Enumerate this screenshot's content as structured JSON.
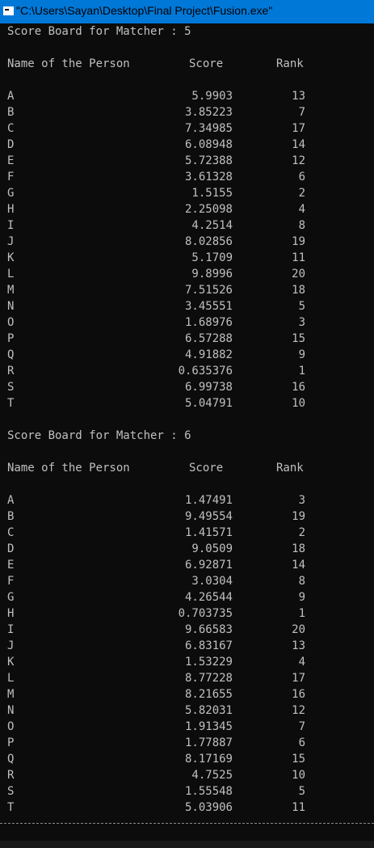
{
  "window": {
    "title": "\"C:\\Users\\Sayan\\Desktop\\Final Project\\Fusion.exe\""
  },
  "headers": {
    "name": "Name of the Person",
    "score": "Score",
    "rank": "Rank"
  },
  "boards": [
    {
      "title": "Score Board for Matcher : 5",
      "rows": [
        {
          "name": "A",
          "score": "5.9903",
          "rank": "13"
        },
        {
          "name": "B",
          "score": "3.85223",
          "rank": "7"
        },
        {
          "name": "C",
          "score": "7.34985",
          "rank": "17"
        },
        {
          "name": "D",
          "score": "6.08948",
          "rank": "14"
        },
        {
          "name": "E",
          "score": "5.72388",
          "rank": "12"
        },
        {
          "name": "F",
          "score": "3.61328",
          "rank": "6"
        },
        {
          "name": "G",
          "score": "1.5155",
          "rank": "2"
        },
        {
          "name": "H",
          "score": "2.25098",
          "rank": "4"
        },
        {
          "name": "I",
          "score": "4.2514",
          "rank": "8"
        },
        {
          "name": "J",
          "score": "8.02856",
          "rank": "19"
        },
        {
          "name": "K",
          "score": "5.1709",
          "rank": "11"
        },
        {
          "name": "L",
          "score": "9.8996",
          "rank": "20"
        },
        {
          "name": "M",
          "score": "7.51526",
          "rank": "18"
        },
        {
          "name": "N",
          "score": "3.45551",
          "rank": "5"
        },
        {
          "name": "O",
          "score": "1.68976",
          "rank": "3"
        },
        {
          "name": "P",
          "score": "6.57288",
          "rank": "15"
        },
        {
          "name": "Q",
          "score": "4.91882",
          "rank": "9"
        },
        {
          "name": "R",
          "score": "0.635376",
          "rank": "1"
        },
        {
          "name": "S",
          "score": "6.99738",
          "rank": "16"
        },
        {
          "name": "T",
          "score": "5.04791",
          "rank": "10"
        }
      ]
    },
    {
      "title": "Score Board for Matcher : 6",
      "rows": [
        {
          "name": "A",
          "score": "1.47491",
          "rank": "3"
        },
        {
          "name": "B",
          "score": "9.49554",
          "rank": "19"
        },
        {
          "name": "C",
          "score": "1.41571",
          "rank": "2"
        },
        {
          "name": "D",
          "score": "9.0509",
          "rank": "18"
        },
        {
          "name": "E",
          "score": "6.92871",
          "rank": "14"
        },
        {
          "name": "F",
          "score": "3.0304",
          "rank": "8"
        },
        {
          "name": "G",
          "score": "4.26544",
          "rank": "9"
        },
        {
          "name": "H",
          "score": "0.703735",
          "rank": "1"
        },
        {
          "name": "I",
          "score": "9.66583",
          "rank": "20"
        },
        {
          "name": "J",
          "score": "6.83167",
          "rank": "13"
        },
        {
          "name": "K",
          "score": "1.53229",
          "rank": "4"
        },
        {
          "name": "L",
          "score": "8.77228",
          "rank": "17"
        },
        {
          "name": "M",
          "score": "8.21655",
          "rank": "16"
        },
        {
          "name": "N",
          "score": "5.82031",
          "rank": "12"
        },
        {
          "name": "O",
          "score": "1.91345",
          "rank": "7"
        },
        {
          "name": "P",
          "score": "1.77887",
          "rank": "6"
        },
        {
          "name": "Q",
          "score": "8.17169",
          "rank": "15"
        },
        {
          "name": "R",
          "score": "4.7525",
          "rank": "10"
        },
        {
          "name": "S",
          "score": "1.55548",
          "rank": "5"
        },
        {
          "name": "T",
          "score": "5.03906",
          "rank": "11"
        }
      ]
    }
  ]
}
